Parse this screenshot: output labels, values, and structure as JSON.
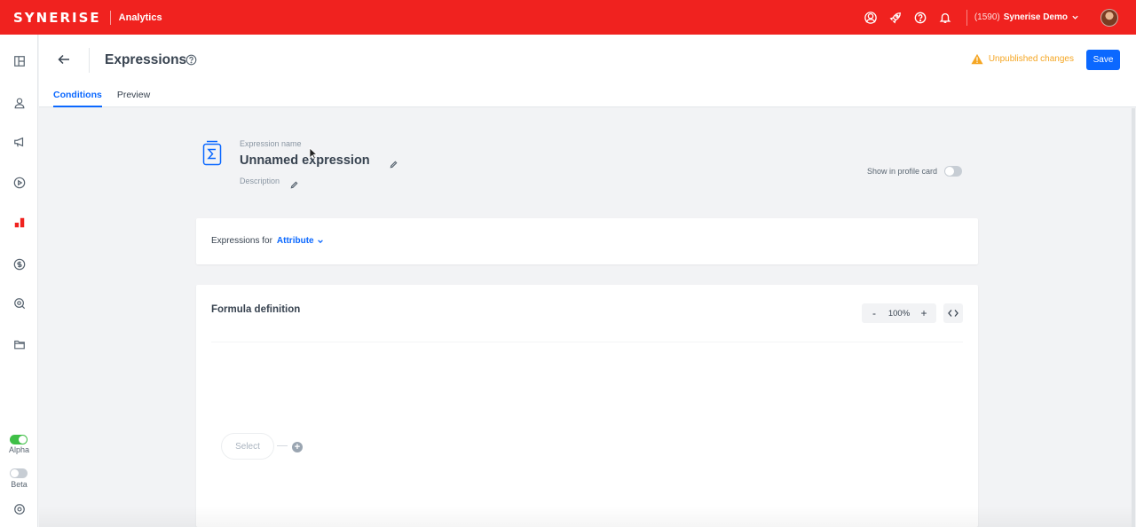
{
  "topbar": {
    "logo": "SYNERISE",
    "app_name": "Analytics",
    "icons": [
      "user-circle-icon",
      "rocket-icon",
      "help-icon",
      "bell-icon"
    ],
    "org_id": "(1590)",
    "org_name": "Synerise Demo",
    "color": "#f0221f"
  },
  "sidebar": {
    "items": [
      "dashboard-icon",
      "profile-icon",
      "megaphone-icon",
      "play-icon",
      "analytics-icon",
      "dollar-icon",
      "search-target-icon",
      "folder-icon"
    ],
    "active": "analytics-icon",
    "alpha_label": "Alpha",
    "alpha_on": true,
    "beta_label": "Beta",
    "beta_on": false,
    "settings_icon": "gear-icon"
  },
  "header": {
    "title": "Expressions",
    "unpublished": "Unpublished changes",
    "save_label": "Save",
    "tabs": [
      {
        "label": "Conditions",
        "active": true
      },
      {
        "label": "Preview",
        "active": false
      }
    ]
  },
  "expression": {
    "name_label": "Expression name",
    "name": "Unnamed expression",
    "description_label": "Description",
    "show_profile_label": "Show in profile card",
    "show_profile_on": false
  },
  "expressions_for": {
    "label": "Expressions for",
    "value": "Attribute"
  },
  "formula": {
    "title": "Formula definition",
    "zoom": "100%",
    "zoom_out": "-",
    "zoom_in": "+",
    "select_placeholder": "Select",
    "add_label": "+"
  },
  "colors": {
    "accent": "#0b68ff",
    "warning": "#f5a623",
    "alpha_toggle": "#3fbf47"
  }
}
